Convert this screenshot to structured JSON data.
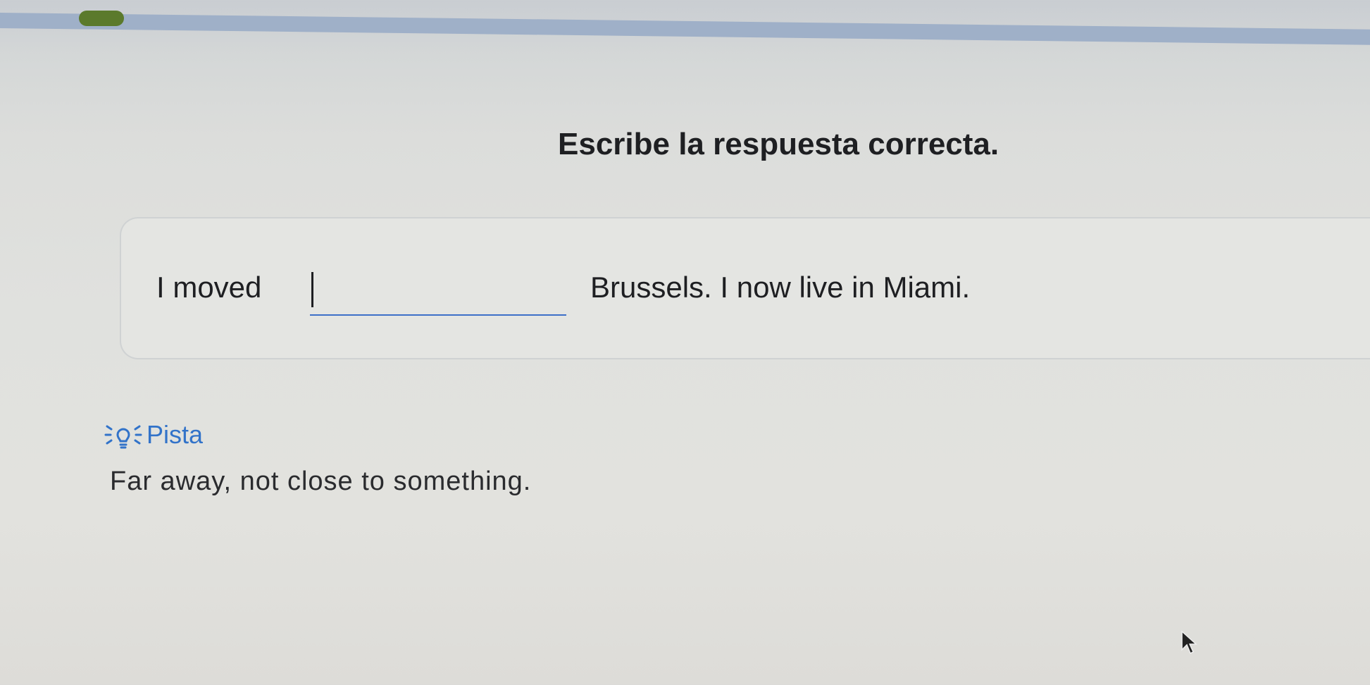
{
  "progress": {
    "fraction": 0.04
  },
  "exercise": {
    "prompt": "Escribe la respuesta correcta.",
    "sentence_before": "I moved",
    "answer_value": "",
    "sentence_after": "Brussels. I now live in Miami."
  },
  "hint": {
    "icon": "lightbulb-icon",
    "label": "Pista",
    "text": "Far away, not close to something."
  },
  "colors": {
    "accent": "#3273c9",
    "progress_fill": "#5b7a2c",
    "progress_track": "#9fb0c8"
  }
}
